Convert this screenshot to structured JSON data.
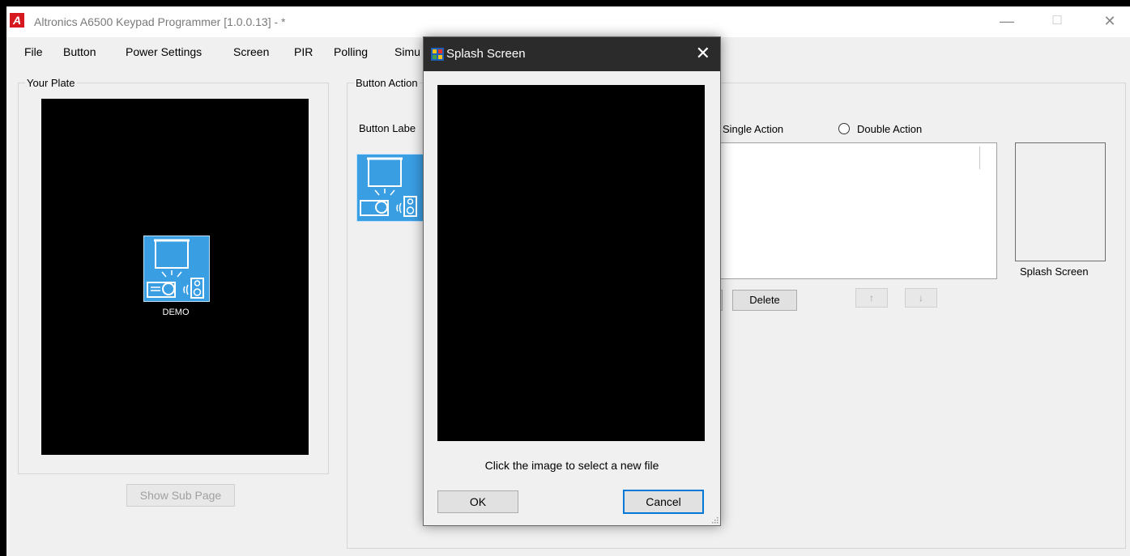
{
  "window": {
    "title": "Altronics A6500 Keypad Programmer [1.0.0.13]  - *",
    "app_icon_letter": "A",
    "minimize": "—",
    "maximize": "☐",
    "close": "✕"
  },
  "menu": {
    "items": [
      "File",
      "Button",
      "Power Settings",
      "Screen",
      "PIR",
      "Polling",
      "Simu"
    ]
  },
  "plate": {
    "group_label": "Your Plate",
    "tile_label": "DEMO",
    "show_sub_page_label": "Show Sub Page"
  },
  "button_action": {
    "group_label": "Button Action",
    "button_label_text": "Button Labe",
    "single_action_label": "Single Action",
    "double_action_label": "Double Action",
    "delete_label": "Delete",
    "up_arrow": "↑",
    "down_arrow": "↓",
    "splash_screen_label": "Splash Screen"
  },
  "dialog": {
    "title": "Splash Screen",
    "close": "✕",
    "hint": "Click the image to select a new file",
    "ok_label": "OK",
    "cancel_label": "Cancel"
  },
  "colors": {
    "tile_blue": "#3a9ee3",
    "dialog_titlebar": "#2b2b2b",
    "focus_border": "#0078d7",
    "app_icon_red": "#d6181f"
  }
}
